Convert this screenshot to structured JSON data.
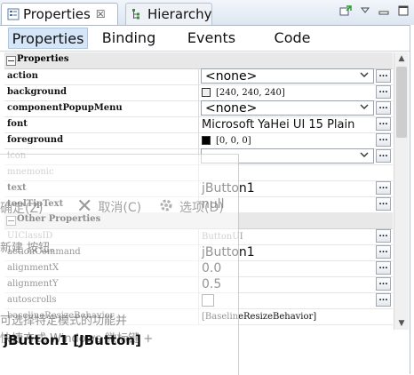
{
  "tabs": [
    {
      "label": "Properties",
      "close": "☒"
    },
    {
      "label": "Hierarchy"
    }
  ],
  "subtabs": [
    "Properties",
    "Binding",
    "Events",
    "Code"
  ],
  "groups": {
    "properties": "Properties",
    "other": "Other Properties"
  },
  "rows": {
    "action": {
      "name": "action",
      "value": "<none>"
    },
    "background": {
      "name": "background",
      "value": "[240, 240, 240]",
      "color": "#f0f0f0"
    },
    "componentPopupMenu": {
      "name": "componentPopupMenu",
      "value": "<none>"
    },
    "font": {
      "name": "font",
      "value": "Microsoft YaHei UI 15 Plain"
    },
    "foreground": {
      "name": "foreground",
      "value": "[0, 0, 0]",
      "color": "#000000"
    },
    "icon": {
      "name": "icon"
    },
    "mnemonic": {
      "name": "mnemonic"
    },
    "text": {
      "name": "text",
      "value": "jButton1"
    },
    "toolTipText": {
      "name": "toolTipText",
      "value": "null"
    },
    "UIClassID": {
      "name": "UIClassID",
      "value": "ButtonUI"
    },
    "actionCommand": {
      "name": "actionCommand",
      "value": "jButton1"
    },
    "alignmentX": {
      "name": "alignmentX",
      "value": "0.0"
    },
    "alignmentY": {
      "name": "alignmentY",
      "value": "0.5"
    },
    "autoscrolls": {
      "name": "autoscrolls"
    },
    "baselineResizeBehavior": {
      "name": "baselineResizeBehavior",
      "value": "[BaselineResizeBehavior]"
    }
  },
  "dots_label": "...",
  "overlay": {
    "btn_ok": "确定(Z)",
    "btn_cancel": "取消(C)",
    "btn_options": "选项(D)",
    "line1": "新建 按钮。",
    "line2": "可选择特定模式的功能并",
    "line3": "快捷方式 Windows 微标键 +"
  },
  "status": "jButton1 [JButton]"
}
